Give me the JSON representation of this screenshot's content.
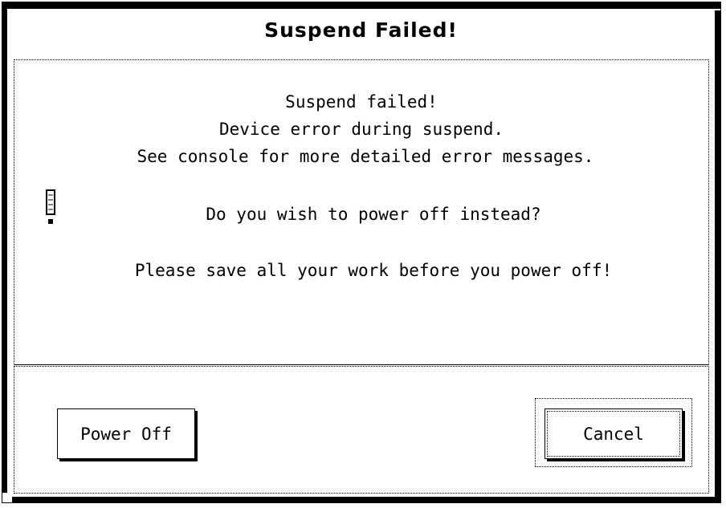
{
  "window": {
    "title": "Suspend Failed!"
  },
  "message": {
    "line1": "Suspend failed!",
    "line2": "Device error during suspend.",
    "line3": "See console for more detailed error messages.",
    "question": "Do you wish to power off instead?",
    "warning": "Please save all your work before you power off!",
    "icon": "exclamation-icon"
  },
  "buttons": {
    "power_off": "Power Off",
    "cancel": "Cancel",
    "default": "Cancel"
  }
}
